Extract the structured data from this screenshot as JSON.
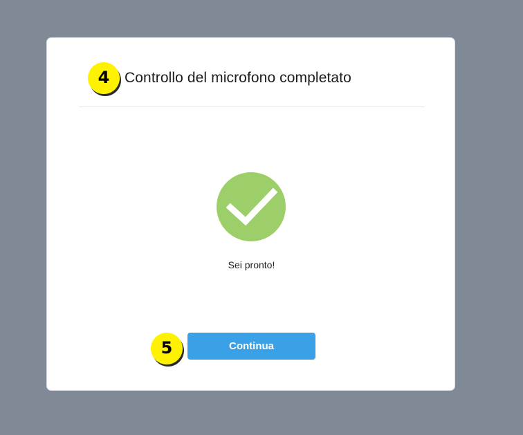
{
  "dialog": {
    "title": "Controllo del microfono completato",
    "status_text": "Sei pronto!",
    "continue_label": "Continua",
    "check_color": "#9ccf6a",
    "button_color": "#3ba1e6"
  },
  "steps": {
    "step_title": "4",
    "step_continue": "5",
    "badge_color": "#fff200"
  },
  "icons": {
    "success": "checkmark-icon"
  }
}
